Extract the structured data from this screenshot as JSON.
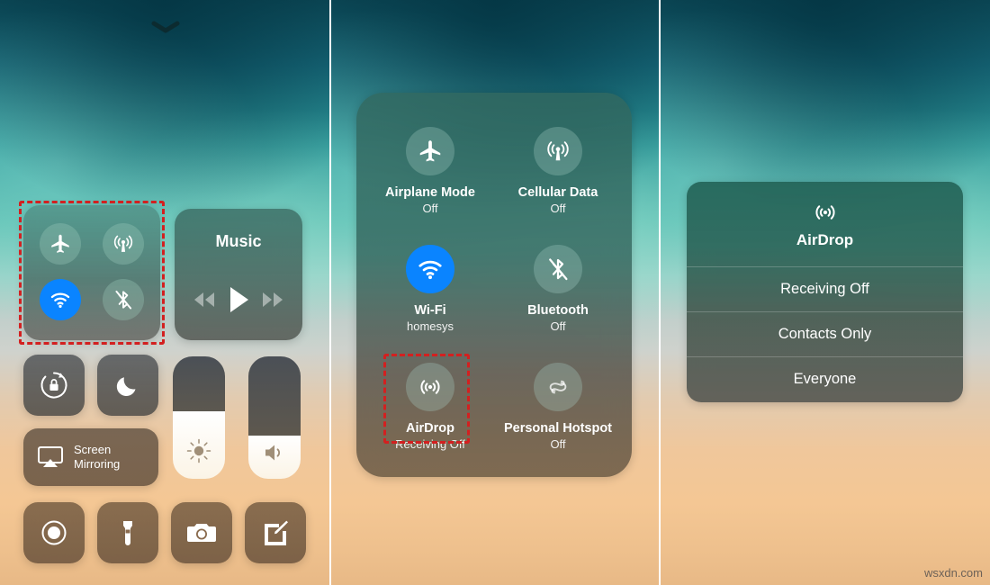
{
  "meta": {
    "watermark": "wsxdn.com"
  },
  "colors": {
    "accent_blue": "#0a84ff",
    "annotation_red": "#d32020",
    "tile_dim": "rgba(170,210,198,0.30)",
    "text_white": "#ffffff"
  },
  "left_screen": {
    "chevron_icon": "chevron-down-icon",
    "connectivity_tile": {
      "toggles": [
        {
          "icon": "airplane-icon",
          "name": "Airplane Mode",
          "state": "off",
          "active": false
        },
        {
          "icon": "cellular-icon",
          "name": "Cellular Data",
          "state": "off",
          "active": false
        },
        {
          "icon": "wifi-icon",
          "name": "Wi-Fi",
          "state": "on",
          "active": true
        },
        {
          "icon": "bluetooth-off-icon",
          "name": "Bluetooth",
          "state": "off",
          "active": false
        }
      ],
      "highlighted": true
    },
    "music": {
      "title": "Music",
      "controls": [
        {
          "icon": "rewind-icon",
          "label": "Rewind"
        },
        {
          "icon": "play-icon",
          "label": "Play"
        },
        {
          "icon": "forward-icon",
          "label": "Fast Forward"
        }
      ]
    },
    "quick_tiles": [
      {
        "icon": "rotation-lock-icon",
        "label": "Rotation Lock"
      },
      {
        "icon": "moon-icon",
        "label": "Do Not Disturb"
      }
    ],
    "screen_mirroring": {
      "icon": "airplay-icon",
      "line1": "Screen",
      "line2": "Mirroring"
    },
    "sliders": [
      {
        "icon": "brightness-icon",
        "label": "Brightness",
        "value_percent": 55
      },
      {
        "icon": "volume-icon",
        "label": "Volume",
        "value_percent": 35
      }
    ],
    "bottom_tiles": [
      {
        "icon": "screen-record-icon",
        "label": "Screen Recording"
      },
      {
        "icon": "flashlight-icon",
        "label": "Flashlight"
      },
      {
        "icon": "camera-icon",
        "label": "Camera"
      },
      {
        "icon": "notes-icon",
        "label": "Notes"
      }
    ]
  },
  "middle_screen": {
    "card_toggles": [
      {
        "icon": "airplane-icon",
        "name": "Airplane Mode",
        "status": "Off",
        "active": false,
        "highlighted": false
      },
      {
        "icon": "cellular-icon",
        "name": "Cellular Data",
        "status": "Off",
        "active": false,
        "highlighted": false
      },
      {
        "icon": "wifi-icon",
        "name": "Wi-Fi",
        "status": "homesys",
        "active": true,
        "highlighted": false
      },
      {
        "icon": "bluetooth-off-icon",
        "name": "Bluetooth",
        "status": "Off",
        "active": false,
        "highlighted": false
      },
      {
        "icon": "airdrop-icon",
        "name": "AirDrop",
        "status": "Receiving Off",
        "active": false,
        "highlighted": true
      },
      {
        "icon": "hotspot-icon",
        "name": "Personal Hotspot",
        "status": "Off",
        "active": false,
        "highlighted": false
      }
    ]
  },
  "right_screen": {
    "airdrop_sheet": {
      "icon": "airdrop-icon",
      "title": "AirDrop",
      "options": [
        {
          "label": "Receiving Off",
          "selected": true
        },
        {
          "label": "Contacts Only",
          "selected": false
        },
        {
          "label": "Everyone",
          "selected": false
        }
      ]
    }
  }
}
